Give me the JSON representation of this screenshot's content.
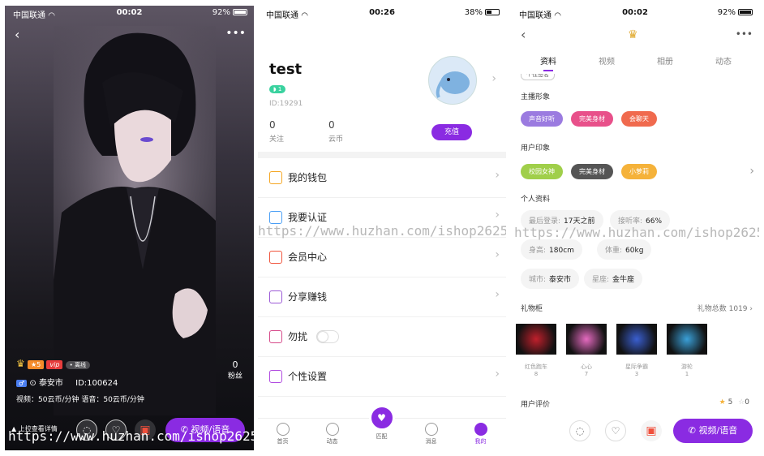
{
  "p1": {
    "status": {
      "carrier": "中国联通",
      "time": "00:02",
      "battery": "92%"
    },
    "badge_level": "5",
    "badge_vip": "vip",
    "badge_status": "• 离线",
    "city": "泰安市",
    "user_id": "ID:100624",
    "fans_count": "0",
    "fans_label": "粉丝",
    "rates": "视频：50云币/分钟   语音：50云币/分钟",
    "swipe_hint": "上拉查看详情",
    "call_button": "视频/语音",
    "watermark": "https://www.huzhan.com/ishop26250"
  },
  "p2": {
    "status": {
      "carrier": "中国联通",
      "time": "00:26",
      "battery": "38%"
    },
    "username": "test",
    "level": "1",
    "user_id": "ID:19291",
    "follow_count": "0",
    "follow_label": "关注",
    "coin_count": "0",
    "coin_label": "云币",
    "recharge": "充值",
    "menu": [
      {
        "label": "我的钱包",
        "color": "#f5a623"
      },
      {
        "label": "我要认证",
        "color": "#4a9ff5"
      },
      {
        "label": "会员中心",
        "color": "#f0543c"
      },
      {
        "label": "分享赚钱",
        "color": "#9b59d6"
      },
      {
        "label": "勿扰",
        "color": "#d64a8a"
      },
      {
        "label": "个性设置",
        "color": "#b14be0"
      }
    ],
    "tabs": [
      "首页",
      "动态",
      "匹配",
      "消息",
      "我的"
    ],
    "watermark": "https://www.huzhan.com/ishop26250"
  },
  "p3": {
    "status": {
      "carrier": "中国联通",
      "time": "00:02",
      "battery": "92%"
    },
    "tabs": [
      "资料",
      "视频",
      "相册",
      "动态"
    ],
    "cut_text": "个性签名",
    "anchor_title": "主播形象",
    "anchor_tags": [
      {
        "label": "声音好听",
        "color": "#9b7be0"
      },
      {
        "label": "完美身材",
        "color": "#e8508a"
      },
      {
        "label": "会聊天",
        "color": "#f06a4e"
      }
    ],
    "impression_title": "用户印象",
    "impression_tags": [
      {
        "label": "校园女神",
        "color": "#a0cf4a"
      },
      {
        "label": "完美身材",
        "color": "#555555"
      },
      {
        "label": "小萝莉",
        "color": "#f5b23a"
      }
    ],
    "profile_title": "个人资料",
    "profile": [
      {
        "k": "最后登录:",
        "v": "17天之前"
      },
      {
        "k": "接听率:",
        "v": "66%"
      },
      {
        "k": "身高:",
        "v": "180cm"
      },
      {
        "k": "体重:",
        "v": "60kg"
      },
      {
        "k": "城市:",
        "v": "泰安市"
      },
      {
        "k": "星座:",
        "v": "金牛座"
      }
    ],
    "gift_title": "礼物柜",
    "gift_total": "礼物总数 1019",
    "gifts": [
      {
        "name": "红色跑车",
        "count": "8"
      },
      {
        "name": "心心",
        "count": "7"
      },
      {
        "name": "星际争霸",
        "count": "3"
      },
      {
        "name": "游轮",
        "count": "1"
      }
    ],
    "review_title": "用户评价",
    "review_good": "5",
    "review_bad": "0",
    "call_button": "视频/语音",
    "watermark": "https://www.huzhan.com/ishop26250"
  }
}
